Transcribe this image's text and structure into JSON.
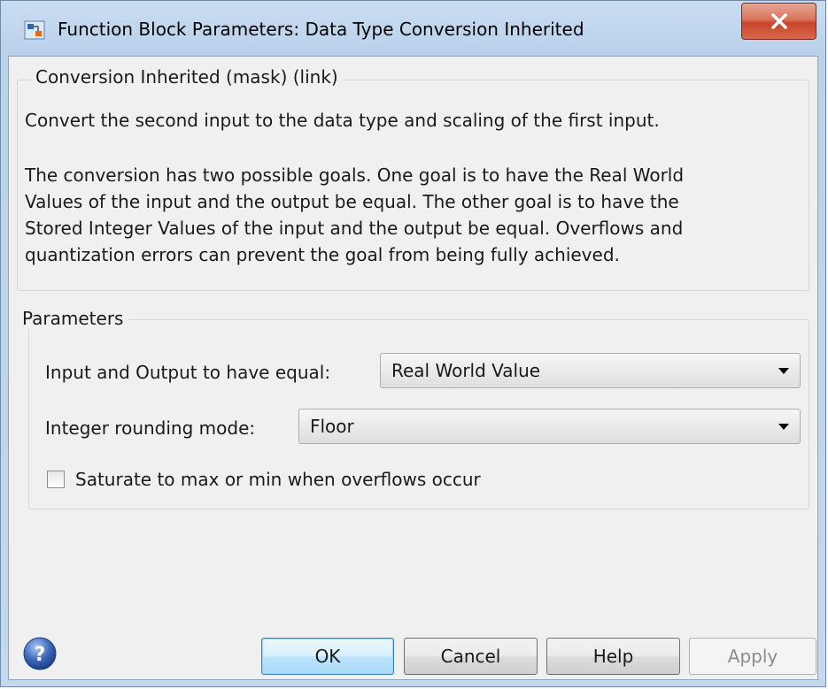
{
  "window": {
    "title": "Function Block Parameters: Data Type Conversion Inherited"
  },
  "description_group": {
    "legend": "Conversion Inherited (mask) (link)",
    "paragraph1": "Convert the second input to the data type and scaling of the first input.",
    "paragraph2_lines": [
      "The conversion has two possible goals.  One goal is to have the Real World",
      "Values of the input and the output be equal.  The other goal is to have the",
      "Stored Integer Values of the input and the output be equal.  Overflows and",
      "quantization errors can prevent the goal from being fully achieved."
    ]
  },
  "parameters_group": {
    "legend": "Parameters",
    "equal_label": "Input and Output to have equal:",
    "equal_value": "Real World Value",
    "rounding_label": "Integer rounding mode:",
    "rounding_value": "Floor",
    "saturate_label": "Saturate to max or min when overflows occur",
    "saturate_checked": false
  },
  "buttons": {
    "ok": "OK",
    "cancel": "Cancel",
    "help": "Help",
    "apply": "Apply"
  },
  "icons": {
    "app": "simulink-block-icon",
    "close": "close-icon",
    "help": "help-icon",
    "dropdown": "chevron-down-icon"
  },
  "colors": {
    "close_button": "#c8462b",
    "help_icon": "#3a67b8",
    "default_button_border": "#3c7fb1"
  }
}
